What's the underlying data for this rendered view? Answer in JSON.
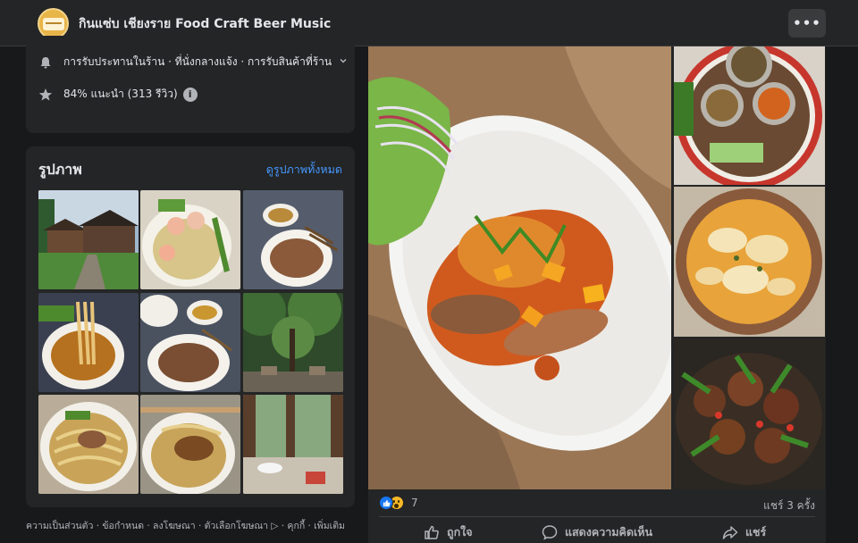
{
  "header": {
    "page_name": "กินแซ่บ เชียงราย Food Craft Beer Music",
    "more_label": "•••"
  },
  "info": {
    "services": "การรับประทานในร้าน · ที่นั่งกลางแจ้ง · การรับสินค้าที่ร้าน",
    "rating": "84% แนะนำ (313 รีวิว)",
    "info_glyph": "i"
  },
  "photos": {
    "title": "รูปภาพ",
    "see_all": "ดูรูปภาพทั้งหมด"
  },
  "footer": {
    "links": "ความเป็นส่วนตัว · ข้อกำหนด · ลงโฆษณา · ตัวเลือกโฆษณา ▷ · คุกกี้ · เพิ่มเติม"
  },
  "post": {
    "reaction_count": "7",
    "shares": "แชร์ 3 ครั้ง",
    "like_label": "ถูกใจ",
    "comment_label": "แสดงความคิดเห็น",
    "share_label": "แชร์"
  },
  "icons": {
    "services": "bell-icon",
    "rating": "star-icon",
    "info": "info-icon",
    "more": "more-horizontal-icon",
    "like": "thumbs-up-icon",
    "comment": "comment-icon",
    "share": "share-arrow-icon"
  },
  "colors": {
    "background": "#18191a",
    "card": "#242526",
    "link": "#4599ff",
    "like_blue": "#1877f2"
  }
}
